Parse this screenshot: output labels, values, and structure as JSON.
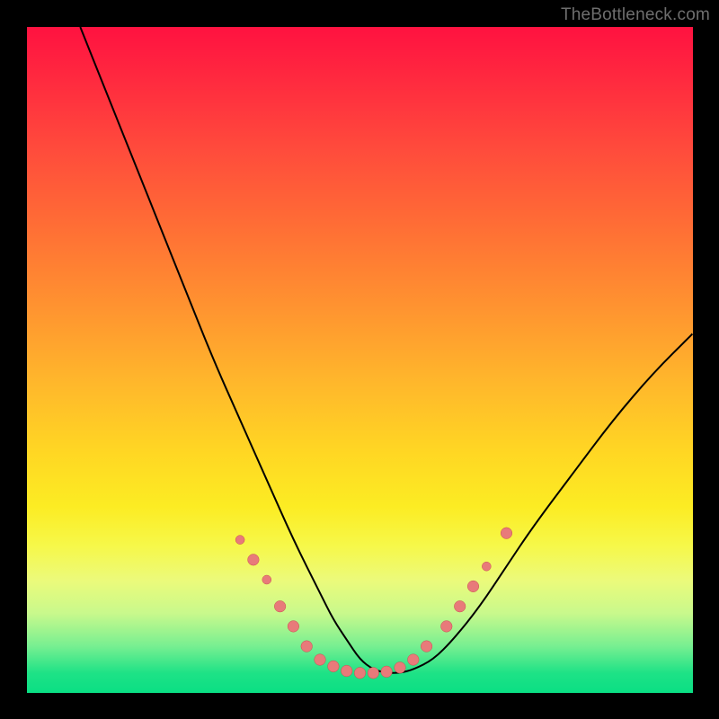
{
  "watermark": "TheBottleneck.com",
  "colors": {
    "page_bg": "#000000",
    "watermark": "#6e6e6e",
    "curve": "#000000",
    "dot_fill": "#e87a7a",
    "dot_stroke": "#c94f4f"
  },
  "chart_data": {
    "type": "line",
    "title": "",
    "xlabel": "",
    "ylabel": "",
    "xlim": [
      0,
      100
    ],
    "ylim": [
      0,
      100
    ],
    "grid": false,
    "legend": false,
    "series": [
      {
        "name": "bottleneck-curve",
        "x": [
          8,
          12,
          16,
          20,
          24,
          28,
          32,
          36,
          40,
          44,
          46,
          48,
          50,
          52,
          54,
          56,
          58,
          61,
          64,
          68,
          72,
          76,
          82,
          88,
          94,
          100
        ],
        "y": [
          100,
          90,
          80,
          70,
          60,
          50,
          41,
          32,
          23,
          15,
          11,
          8,
          5,
          3.5,
          3,
          3,
          3.5,
          5,
          8,
          13,
          19,
          25,
          33,
          41,
          48,
          54
        ]
      }
    ],
    "markers": [
      {
        "x": 32,
        "y": 23,
        "r": 4
      },
      {
        "x": 34,
        "y": 20,
        "r": 5
      },
      {
        "x": 36,
        "y": 17,
        "r": 4
      },
      {
        "x": 38,
        "y": 13,
        "r": 5
      },
      {
        "x": 40,
        "y": 10,
        "r": 5
      },
      {
        "x": 42,
        "y": 7,
        "r": 5
      },
      {
        "x": 44,
        "y": 5,
        "r": 5
      },
      {
        "x": 46,
        "y": 4,
        "r": 5
      },
      {
        "x": 48,
        "y": 3.3,
        "r": 5
      },
      {
        "x": 50,
        "y": 3,
        "r": 5
      },
      {
        "x": 52,
        "y": 3,
        "r": 5
      },
      {
        "x": 54,
        "y": 3.2,
        "r": 5
      },
      {
        "x": 56,
        "y": 3.8,
        "r": 5
      },
      {
        "x": 58,
        "y": 5,
        "r": 5
      },
      {
        "x": 60,
        "y": 7,
        "r": 5
      },
      {
        "x": 63,
        "y": 10,
        "r": 5
      },
      {
        "x": 65,
        "y": 13,
        "r": 5
      },
      {
        "x": 67,
        "y": 16,
        "r": 5
      },
      {
        "x": 69,
        "y": 19,
        "r": 4
      },
      {
        "x": 72,
        "y": 24,
        "r": 5
      }
    ]
  }
}
